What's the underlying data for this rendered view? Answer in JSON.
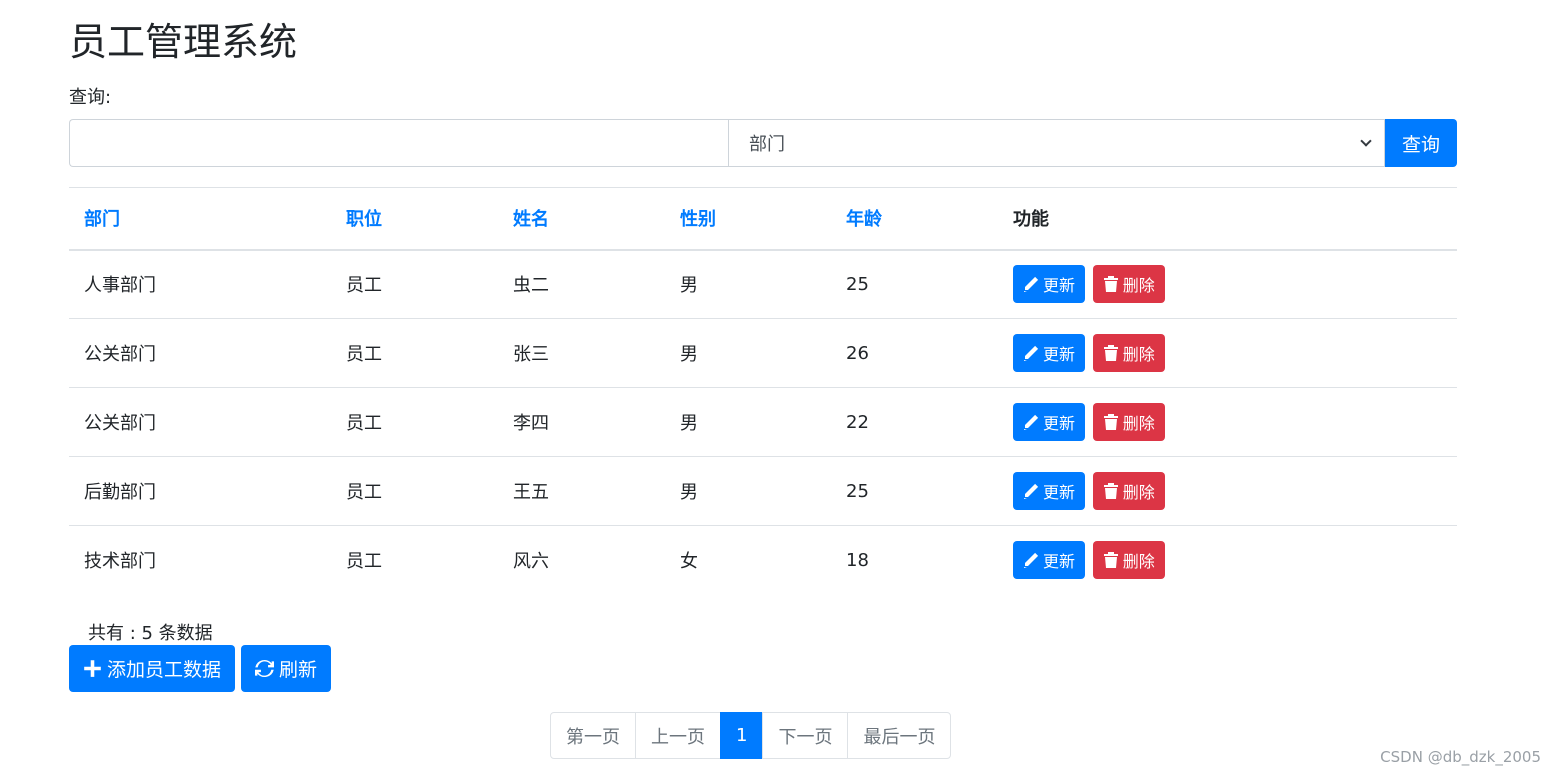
{
  "page": {
    "title": "员工管理系统",
    "query_label": "查询:"
  },
  "search": {
    "input_value": "",
    "select_value": "部门",
    "button_label": "查询"
  },
  "table": {
    "headers": [
      "部门",
      "职位",
      "姓名",
      "性别",
      "年龄",
      "功能"
    ],
    "rows": [
      {
        "dept": "人事部门",
        "position": "员工",
        "name": "虫二",
        "sex": "男",
        "age": "25"
      },
      {
        "dept": "公关部门",
        "position": "员工",
        "name": "张三",
        "sex": "男",
        "age": "26"
      },
      {
        "dept": "公关部门",
        "position": "员工",
        "name": "李四",
        "sex": "男",
        "age": "22"
      },
      {
        "dept": "后勤部门",
        "position": "员工",
        "name": "王五",
        "sex": "男",
        "age": "25"
      },
      {
        "dept": "技术部门",
        "position": "员工",
        "name": "风六",
        "sex": "女",
        "age": "18"
      }
    ],
    "update_label": "更新",
    "delete_label": "删除"
  },
  "footer": {
    "total_text": "共有 : 5 条数据",
    "add_label": "添加员工数据",
    "refresh_label": "刷新"
  },
  "pagination": {
    "first": "第一页",
    "prev": "上一页",
    "current": "1",
    "next": "下一页",
    "last": "最后一页"
  },
  "watermark": "CSDN @db_dzk_2005",
  "colors": {
    "primary": "#007bff",
    "danger": "#dc3545",
    "border": "#dee2e6"
  },
  "icons": {
    "update": "pencil-icon",
    "delete": "trash-icon",
    "add": "plus-icon",
    "refresh": "refresh-icon",
    "select": "chevron-down-icon"
  }
}
